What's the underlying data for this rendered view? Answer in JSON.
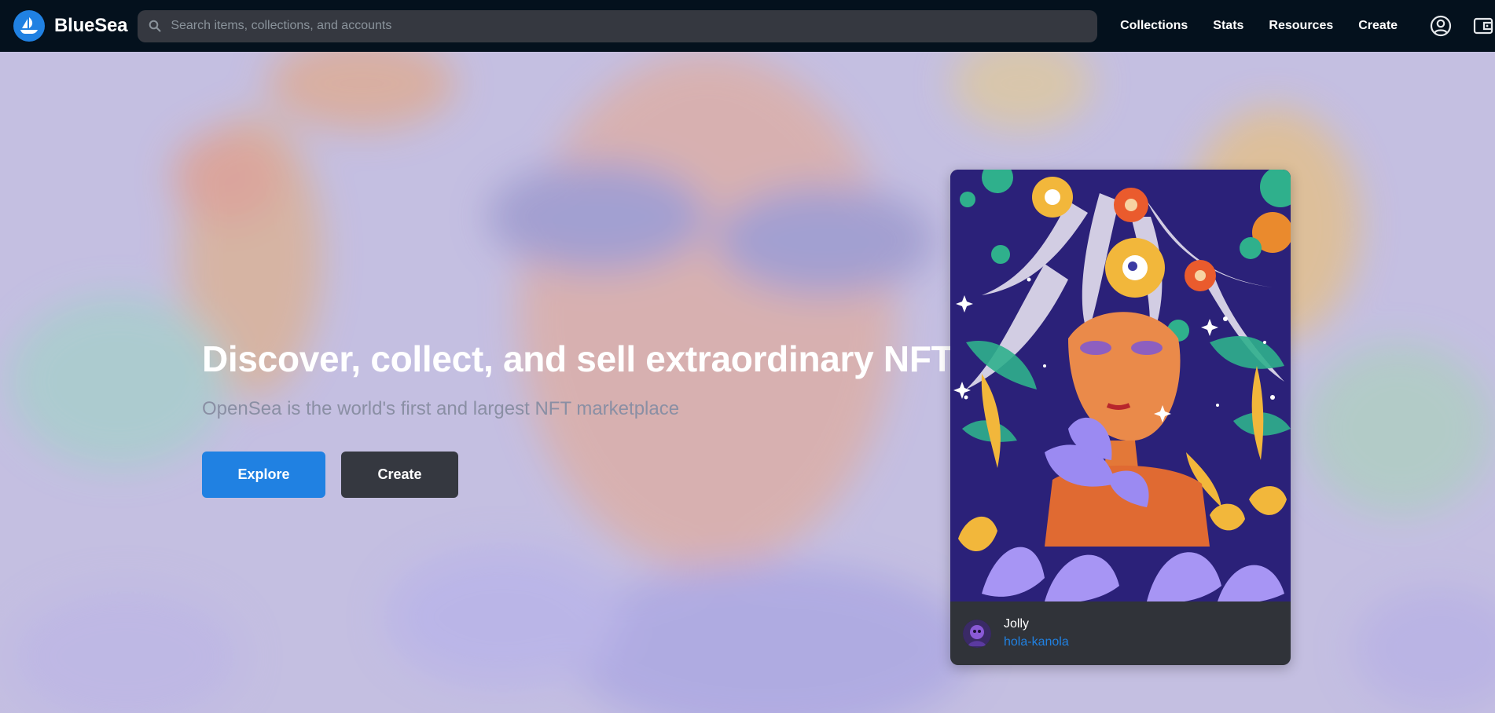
{
  "brand": {
    "name": "BlueSea",
    "logo_icon": "sailboat-icon",
    "accent": "#2081e2"
  },
  "search": {
    "placeholder": "Search items, collections, and accounts",
    "value": ""
  },
  "nav": {
    "links": [
      "Collections",
      "Stats",
      "Resources",
      "Create"
    ],
    "account_icon": "account-circle-icon",
    "wallet_icon": "wallet-icon"
  },
  "hero": {
    "title": "Discover, collect, and sell extraordinary NFTs",
    "subtitle": "OpenSea is the world's first and largest NFT marketplace",
    "primary_button": "Explore",
    "secondary_button": "Create"
  },
  "featured": {
    "title": "Jolly",
    "creator": "hola-kanola"
  },
  "colors": {
    "navbar": "#04111d",
    "search_bg": "#353840",
    "primary": "#2081e2",
    "secondary_button": "#353840",
    "card_bg": "#303339"
  }
}
